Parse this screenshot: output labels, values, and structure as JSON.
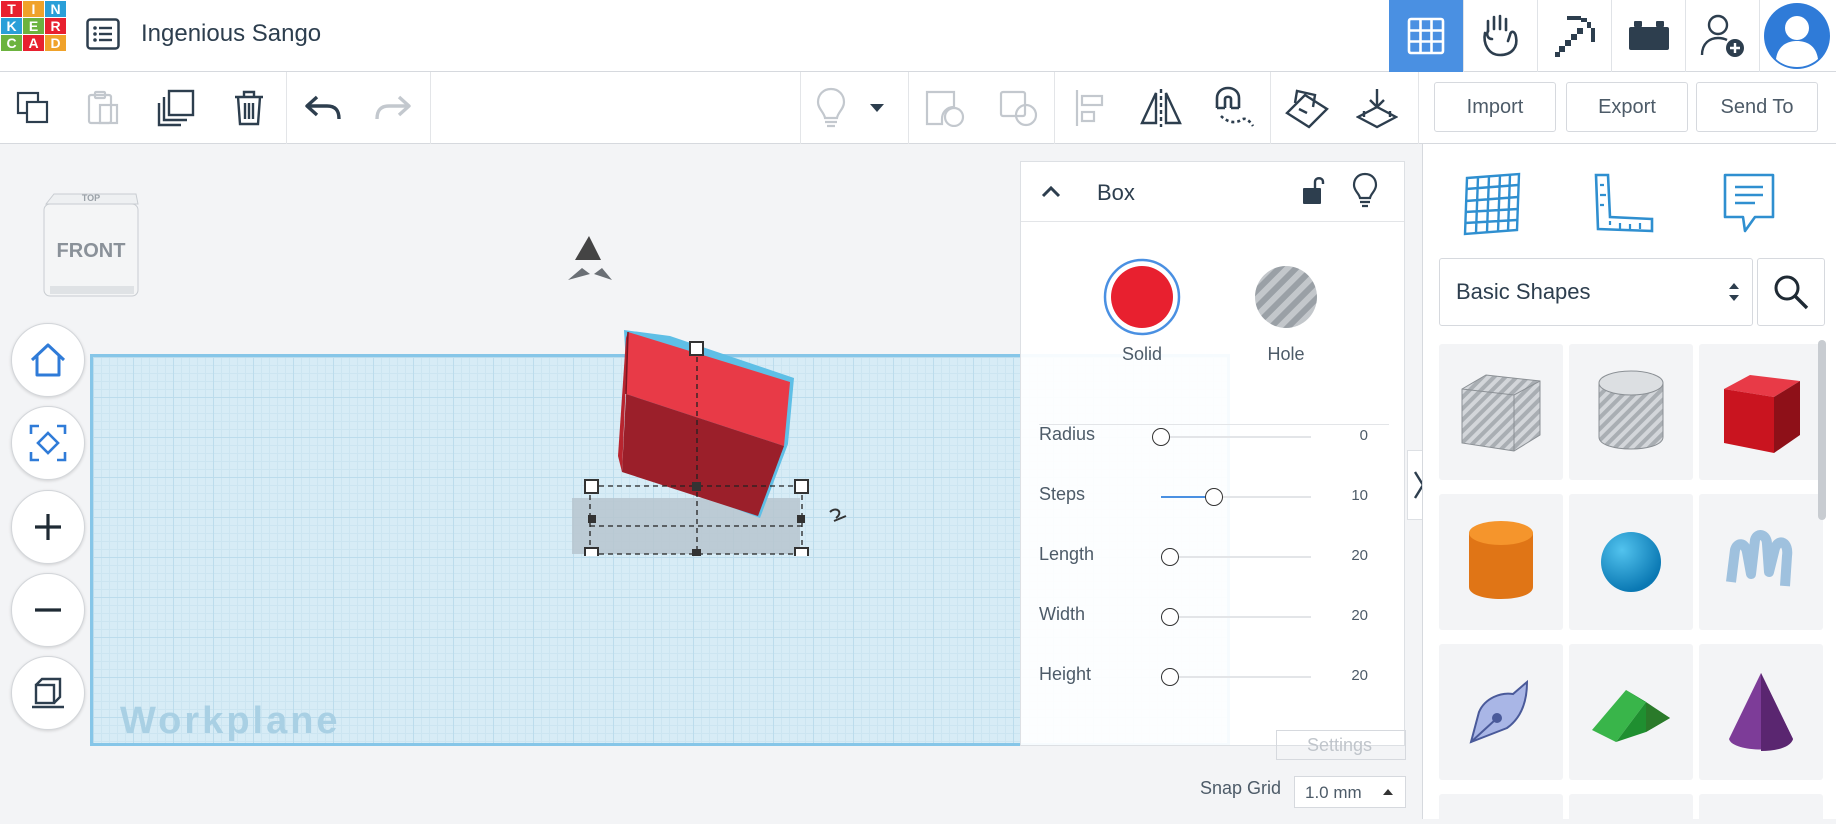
{
  "app": {
    "logo_letters": [
      "T",
      "I",
      "N",
      "K",
      "E",
      "R",
      "C",
      "A",
      "D"
    ],
    "project_title": "Ingenious Sango"
  },
  "topnav": {
    "items": [
      {
        "name": "3d-design-grid-icon",
        "active": true
      },
      {
        "name": "codeblocks-icon",
        "active": false
      },
      {
        "name": "minecraft-pickaxe-icon",
        "active": false
      },
      {
        "name": "lego-brick-icon",
        "active": false
      },
      {
        "name": "invite-user-icon",
        "active": false
      }
    ]
  },
  "toolbar": {
    "import_label": "Import",
    "export_label": "Export",
    "sendto_label": "Send To"
  },
  "viewcube": {
    "top_label": "TOP",
    "front_label": "FRONT"
  },
  "workplane": {
    "label": "Workplane"
  },
  "inspector": {
    "title": "Box",
    "solid_label": "Solid",
    "hole_label": "Hole",
    "solid_color": "#e8202f",
    "props": [
      {
        "label": "Radius",
        "value": "0",
        "fraction": 0.0
      },
      {
        "label": "Steps",
        "value": "10",
        "fraction": 0.35
      },
      {
        "label": "Length",
        "value": "20",
        "fraction": 0.06
      },
      {
        "label": "Width",
        "value": "20",
        "fraction": 0.06
      },
      {
        "label": "Height",
        "value": "20",
        "fraction": 0.06
      }
    ]
  },
  "settings": {
    "label": "Settings"
  },
  "snap": {
    "label": "Snap Grid",
    "value": "1.0 mm"
  },
  "library": {
    "category": "Basic Shapes",
    "shapes": [
      "box-hole-shape",
      "cylinder-hole-shape",
      "box-shape",
      "cylinder-shape",
      "sphere-shape",
      "scribble-shape",
      "pen-shape",
      "roof-shape",
      "cone-shape"
    ]
  },
  "colors": {
    "accent": "#4a90e2",
    "solid_red": "#e8202f",
    "workplane": "#d7ecf6"
  }
}
